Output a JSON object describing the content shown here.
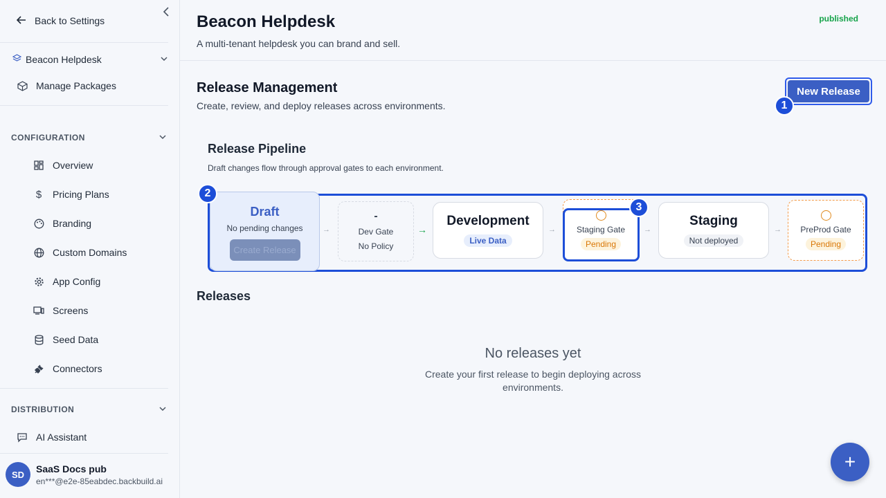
{
  "sidebar": {
    "back_label": "Back to Settings",
    "project": "Beacon Helpdesk",
    "manage_packages": "Manage Packages",
    "configuration_label": "CONFIGURATION",
    "config_items": [
      "Overview",
      "Pricing Plans",
      "Branding",
      "Custom Domains",
      "App Config",
      "Screens",
      "Seed Data",
      "Connectors"
    ],
    "distribution_label": "DISTRIBUTION",
    "distribution_items": [
      "AI Assistant"
    ],
    "user": {
      "initials": "SD",
      "name": "SaaS Docs pub",
      "email": "en***@e2e-85eabdec.backbuild.ai"
    }
  },
  "header": {
    "title": "Beacon Helpdesk",
    "subtitle": "A multi-tenant helpdesk you can brand and sell.",
    "status": "published"
  },
  "release_management": {
    "title": "Release Management",
    "subtitle": "Create, review, and deploy releases across environments.",
    "new_release_label": "New Release"
  },
  "pipeline": {
    "title": "Release Pipeline",
    "subtitle": "Draft changes flow through approval gates to each environment.",
    "draft": {
      "title": "Draft",
      "status": "No pending changes",
      "button": "Create Release"
    },
    "dev_gate": {
      "symbol": "-",
      "title": "Dev Gate",
      "status": "No Policy"
    },
    "development": {
      "title": "Development",
      "status": "Live Data"
    },
    "staging_gate": {
      "title": "Staging Gate",
      "status": "Pending"
    },
    "staging": {
      "title": "Staging",
      "status": "Not deployed"
    },
    "preprod_gate": {
      "title": "PreProd Gate",
      "status": "Pending"
    }
  },
  "releases": {
    "title": "Releases",
    "empty_title": "No releases yet",
    "empty_subtitle": "Create your first release to begin deploying across environments."
  },
  "markers": [
    "1",
    "2",
    "3"
  ],
  "fab_label": "+",
  "colors": {
    "accent": "#3b5fc4",
    "focus": "#1d4ed8",
    "published": "#16a34a",
    "pending": "#d97706"
  }
}
